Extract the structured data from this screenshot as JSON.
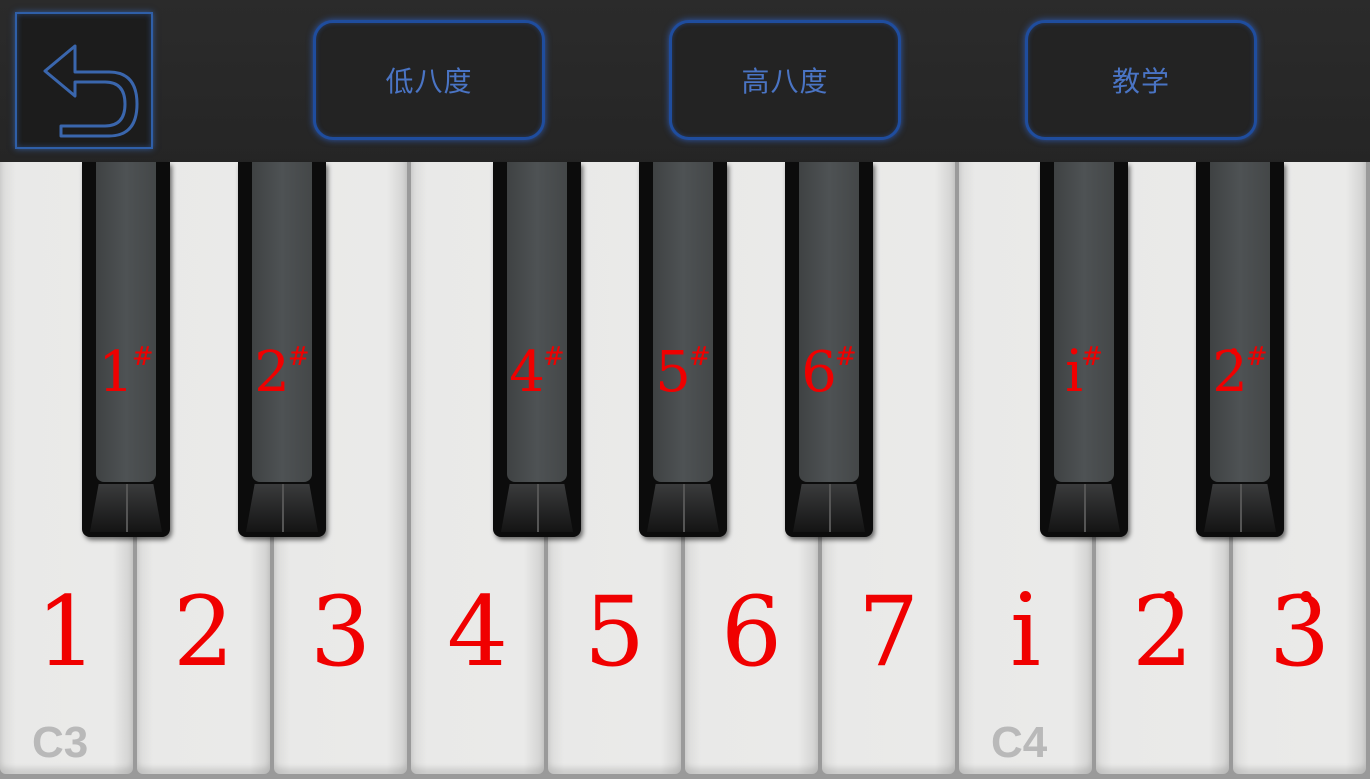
{
  "toolbar": {
    "back_icon": "back-arrow-icon",
    "buttons": [
      {
        "label": "低八度"
      },
      {
        "label": "高八度"
      },
      {
        "label": "教学"
      }
    ]
  },
  "keyboard": {
    "white_keys": [
      {
        "label": "1"
      },
      {
        "label": "2"
      },
      {
        "label": "3"
      },
      {
        "label": "4"
      },
      {
        "label": "5"
      },
      {
        "label": "6"
      },
      {
        "label": "7"
      },
      {
        "label": "i̇"
      },
      {
        "label": "2̇"
      },
      {
        "label": "3̇"
      }
    ],
    "octave_labels": [
      "C3",
      "C4"
    ],
    "black_keys": [
      {
        "label": "1",
        "sharp": "#"
      },
      {
        "label": "2",
        "sharp": "#"
      },
      {
        "label": "4",
        "sharp": "#"
      },
      {
        "label": "5",
        "sharp": "#"
      },
      {
        "label": "6",
        "sharp": "#"
      },
      {
        "label": "i̇",
        "sharp": "#"
      },
      {
        "label": "2̇",
        "sharp": "#"
      }
    ]
  },
  "colors": {
    "note_label": "#f00000",
    "button_border": "#1f4d9e",
    "button_text": "#4a74c4"
  }
}
